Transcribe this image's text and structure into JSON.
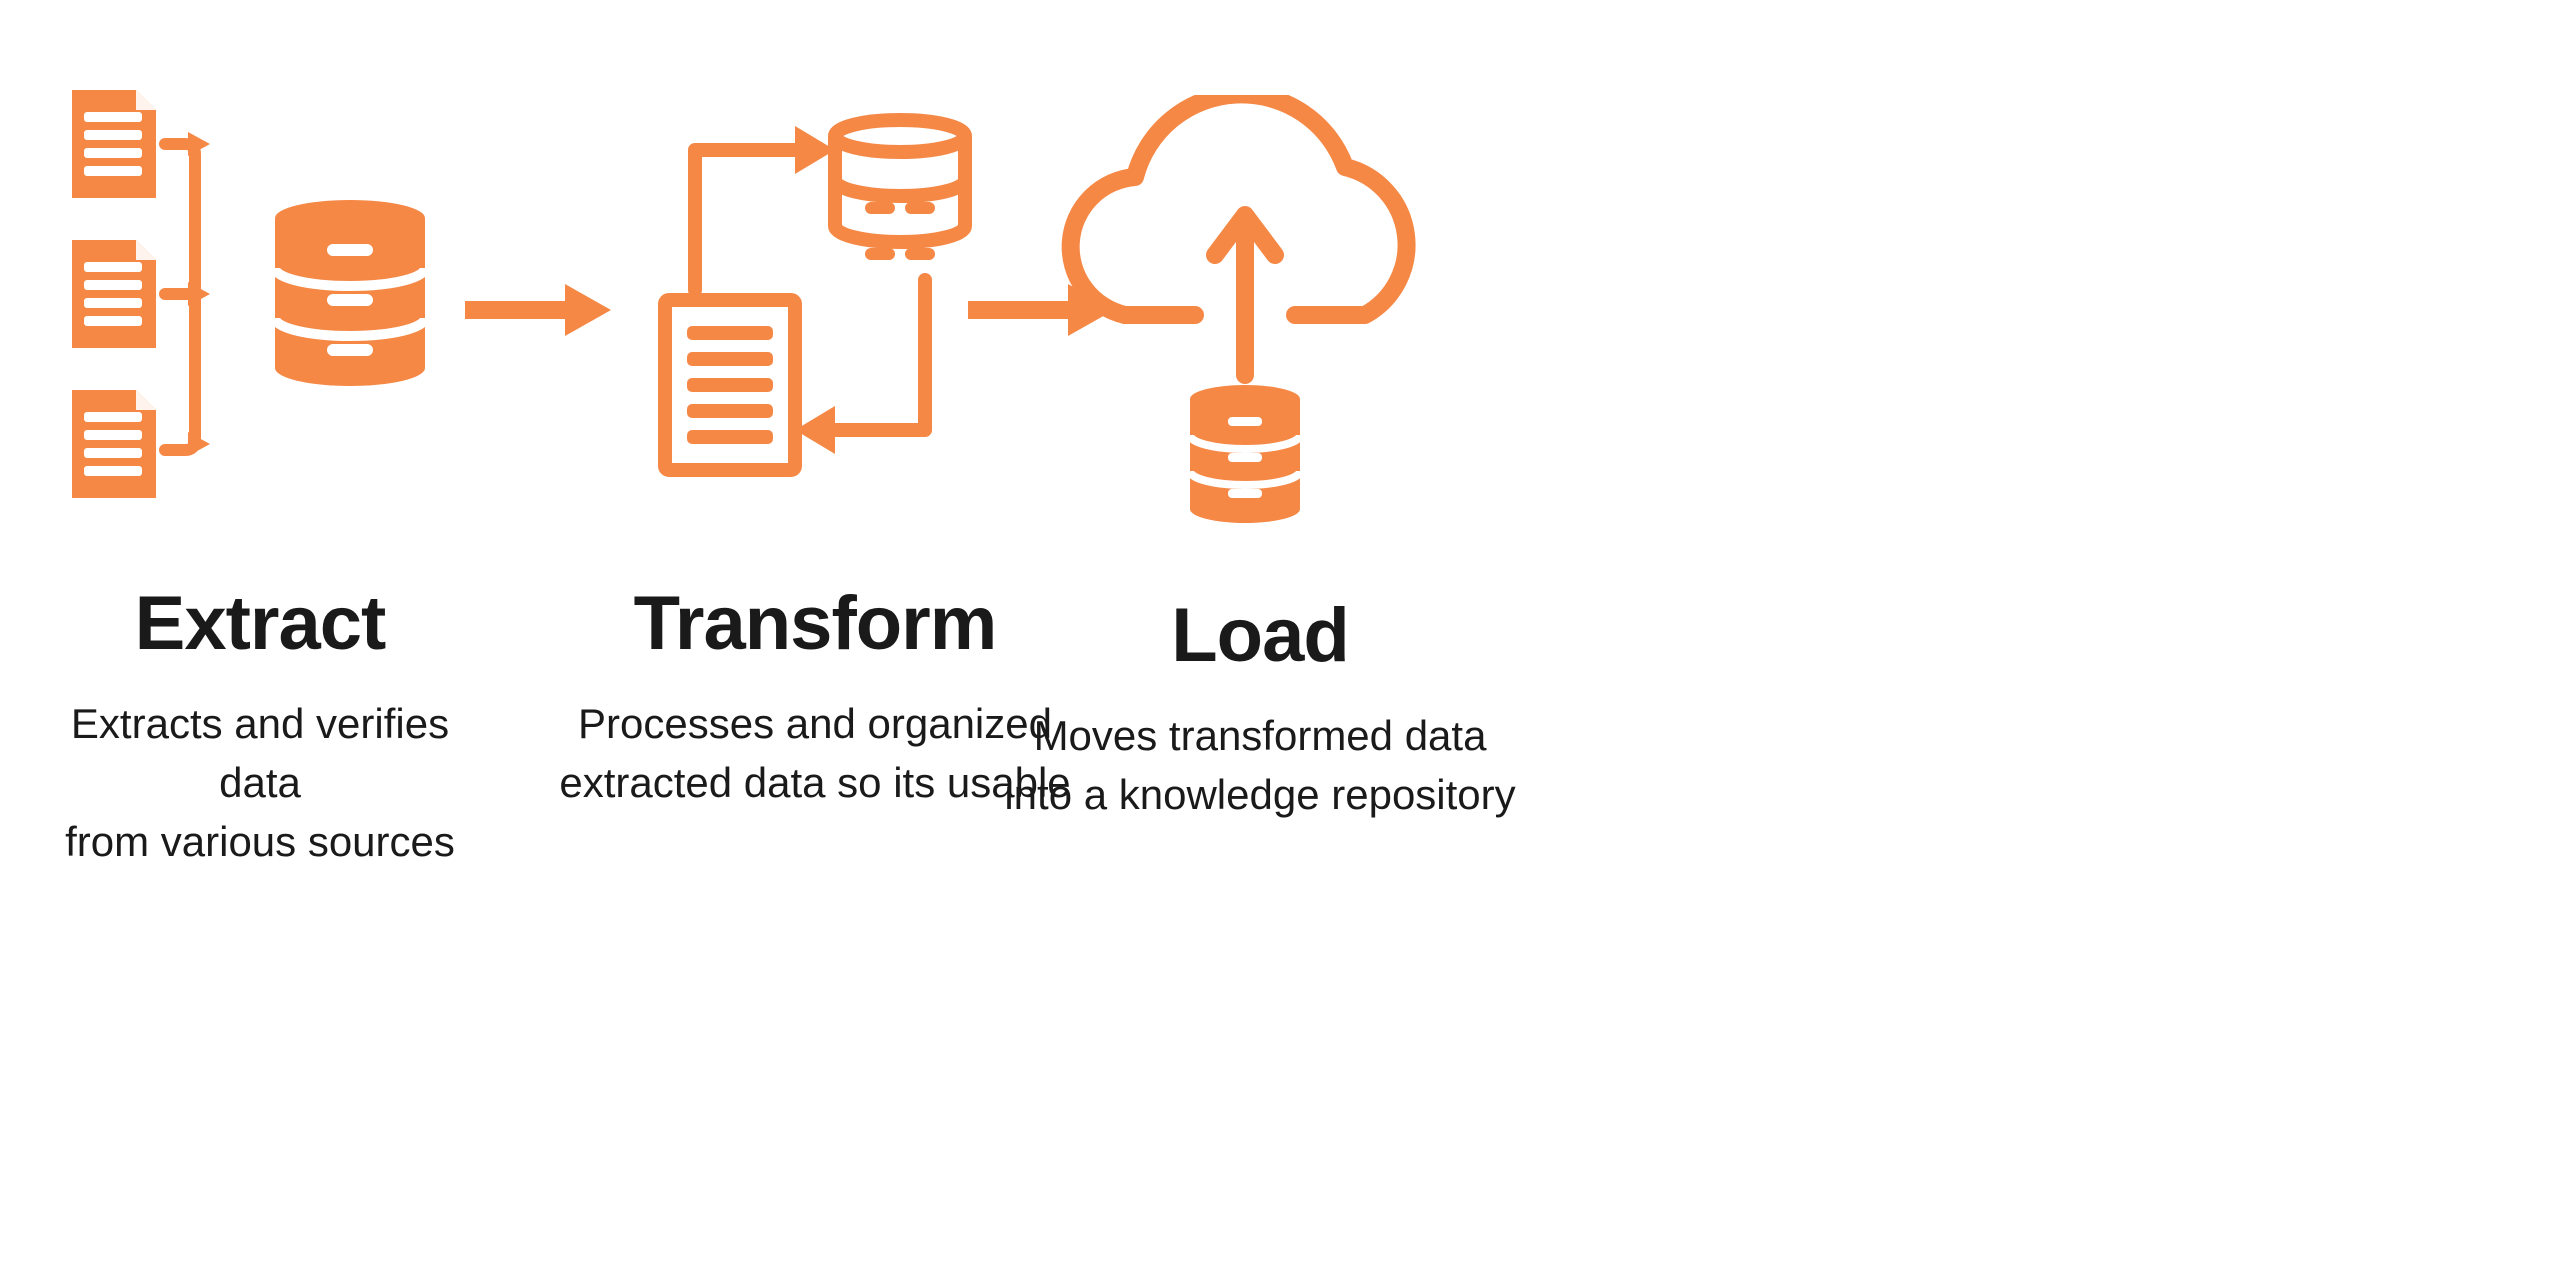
{
  "colors": {
    "brand": "#f58845",
    "text": "#1a1a1a"
  },
  "steps": [
    {
      "title": "Extract",
      "description_line1": "Extracts and verifies data",
      "description_line2": "from various sources"
    },
    {
      "title": "Transform",
      "description_line1": "Processes and organized",
      "description_line2": "extracted data so its usable"
    },
    {
      "title": "Load",
      "description_line1": "Moves transformed data",
      "description_line2": "into a knowledge repository"
    }
  ]
}
